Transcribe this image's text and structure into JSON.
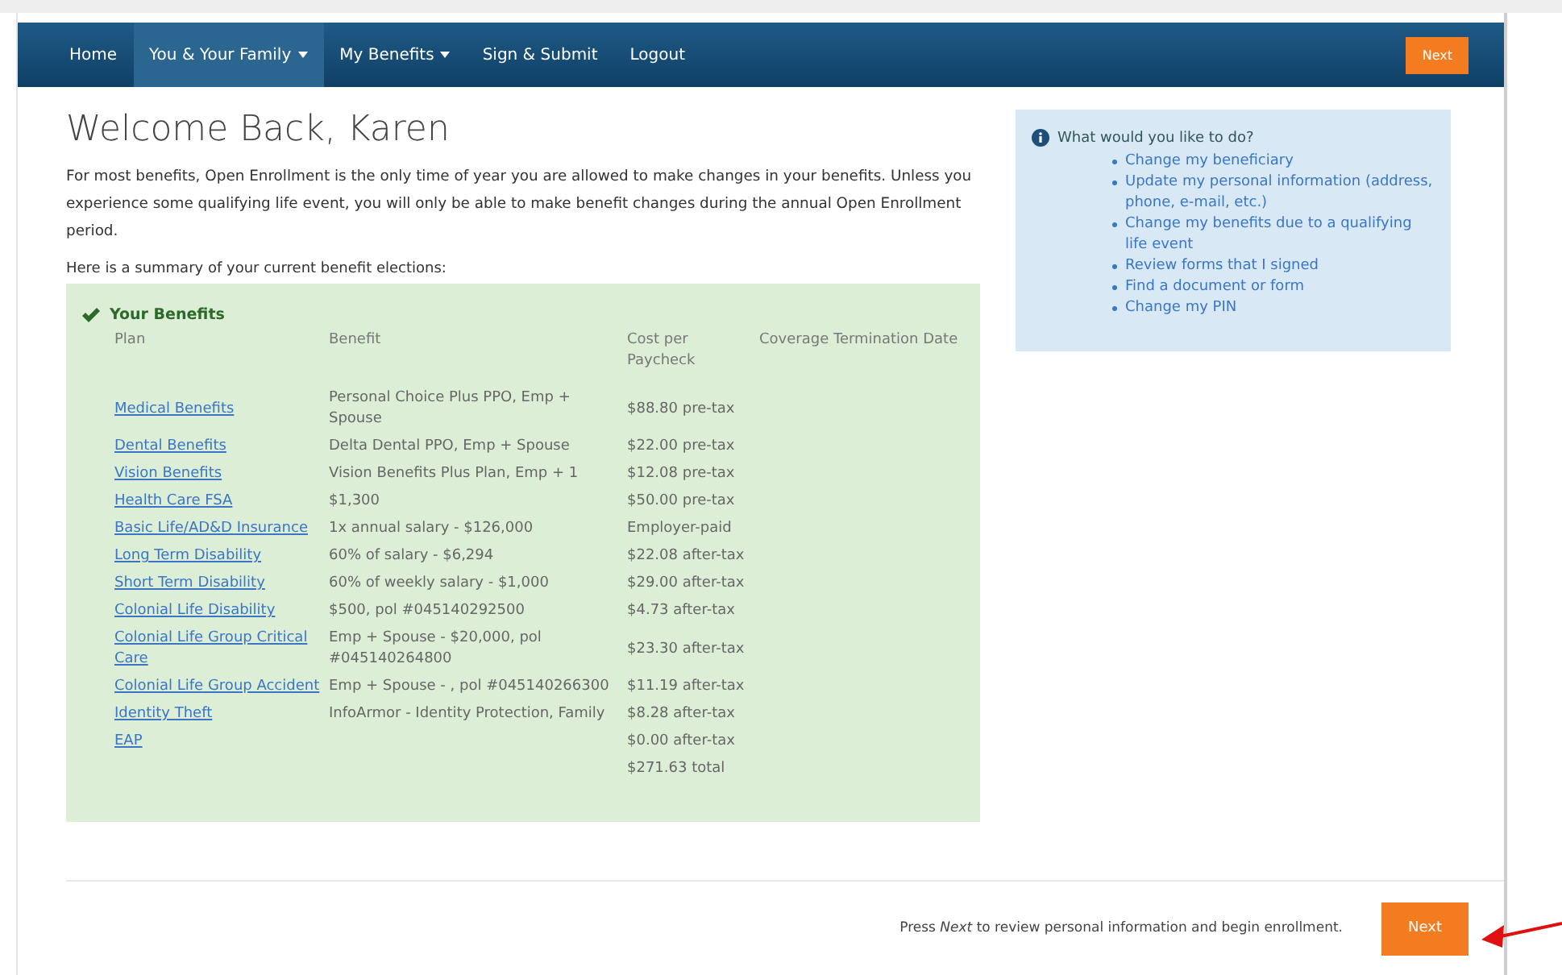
{
  "nav": {
    "items": [
      {
        "label": "Home",
        "selected": false,
        "dropdown": false
      },
      {
        "label": "You & Your Family",
        "selected": true,
        "dropdown": true
      },
      {
        "label": "My Benefits",
        "selected": false,
        "dropdown": true
      },
      {
        "label": "Sign & Submit",
        "selected": false,
        "dropdown": false
      },
      {
        "label": "Logout",
        "selected": false,
        "dropdown": false
      }
    ],
    "next_button": "Next"
  },
  "welcome": {
    "title": "Welcome Back, Karen",
    "intro": "For most benefits, Open Enrollment is the only time of year you are allowed to make changes in your benefits. Unless you experience some qualifying life event, you will only be able to make benefit changes during the annual Open Enrollment period.",
    "summary_label": "Here is a summary of your current benefit elections:"
  },
  "benefits": {
    "title": "Your Benefits",
    "columns": [
      "Plan",
      "Benefit",
      "Cost per Paycheck",
      "Coverage Termination Date"
    ],
    "rows": [
      {
        "plan": "Medical Benefits",
        "benefit": "Personal Choice Plus PPO, Emp + Spouse",
        "cost": "$88.80 pre-tax"
      },
      {
        "plan": "Dental Benefits",
        "benefit": "Delta Dental PPO, Emp + Spouse",
        "cost": "$22.00 pre-tax"
      },
      {
        "plan": "Vision Benefits",
        "benefit": "Vision Benefits Plus Plan, Emp + 1",
        "cost": "$12.08 pre-tax"
      },
      {
        "plan": "Health Care FSA",
        "benefit": "$1,300",
        "cost": "$50.00 pre-tax"
      },
      {
        "plan": "Basic Life/AD&D Insurance",
        "benefit": "1x annual salary - $126,000",
        "cost": "Employer-paid"
      },
      {
        "plan": "Long Term Disability",
        "benefit": "60% of salary - $6,294",
        "cost": "$22.08 after-tax"
      },
      {
        "plan": "Short Term Disability",
        "benefit": "60% of weekly salary - $1,000",
        "cost": "$29.00 after-tax"
      },
      {
        "plan": "Colonial Life Disability",
        "benefit": "$500, pol #045140292500",
        "cost": "$4.73 after-tax"
      },
      {
        "plan": "Colonial Life Group Critical Care",
        "benefit": "Emp + Spouse - $20,000, pol #045140264800",
        "cost": "$23.30 after-tax"
      },
      {
        "plan": "Colonial Life Group Accident",
        "benefit": "Emp + Spouse - , pol #045140266300",
        "cost": "$11.19 after-tax"
      },
      {
        "plan": "Identity Theft",
        "benefit": "InfoArmor - Identity Protection, Family",
        "cost": "$8.28 after-tax"
      },
      {
        "plan": "EAP",
        "cost": "$0.00 after-tax"
      }
    ],
    "total": "$271.63 total"
  },
  "actions": {
    "title": "What would you like to do?",
    "links": [
      "Change my beneficiary",
      "Update my personal information (address, phone, e-mail, etc.)",
      "Change my benefits due to a qualifying life event",
      "Review forms that I signed",
      "Find a document or form",
      "Change my PIN"
    ]
  },
  "footer": {
    "instruction": "Press *Next* to review personal information and begin enrollment.",
    "next_button": "Next"
  }
}
